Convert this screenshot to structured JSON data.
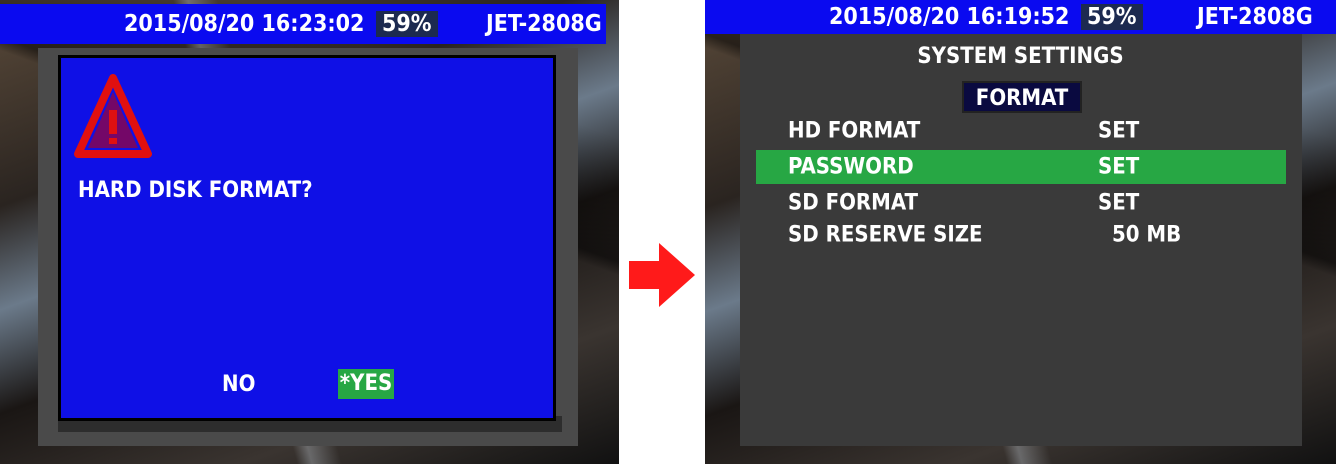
{
  "left_screen": {
    "status": {
      "datetime": "2015/08/20 16:23:02",
      "battery": "59%",
      "device": "JET-2808G"
    },
    "dialog": {
      "message": "HARD DISK FORMAT?",
      "options": {
        "no": "NO",
        "yes": "*YES"
      },
      "selected": "yes"
    }
  },
  "arrow": {
    "color": "#ff1a1a"
  },
  "right_screen": {
    "status": {
      "datetime": "2015/08/20 16:19:52",
      "battery": "59%",
      "device": "JET-2808G"
    },
    "title": "SYSTEM SETTINGS",
    "tab": "FORMAT",
    "rows": [
      {
        "label": "HD FORMAT",
        "value": "SET",
        "selected": false
      },
      {
        "label": "PASSWORD",
        "value": "SET",
        "selected": true
      },
      {
        "label": "SD FORMAT",
        "value": "SET",
        "selected": false
      },
      {
        "label": "SD RESERVE SIZE",
        "value": "50 MB",
        "selected": false
      }
    ]
  },
  "colors": {
    "status_bar": "#0a0af0",
    "dialog": "#0f10e6",
    "highlight": "#27a744",
    "menu_panel": "#3a3a3a",
    "warning": "#e01010"
  }
}
